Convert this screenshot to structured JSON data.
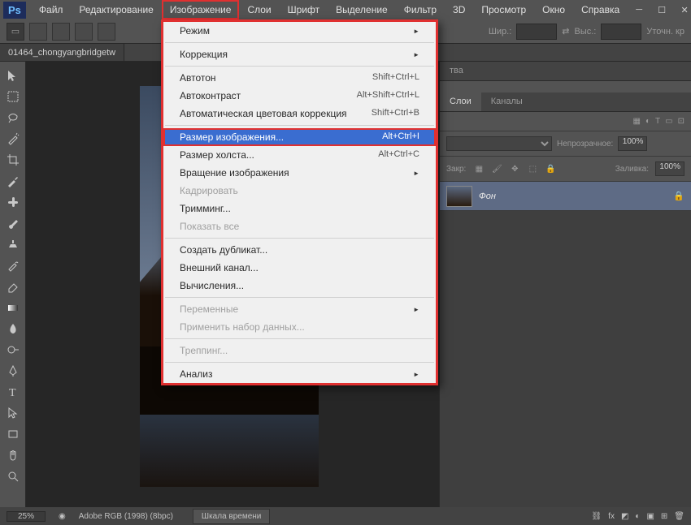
{
  "app_abbr": "Ps",
  "menubar": {
    "items": [
      "Файл",
      "Редактирование",
      "Изображение",
      "Слои",
      "Шрифт",
      "Выделение",
      "Фильтр",
      "3D",
      "Просмотр",
      "Окно",
      "Справка"
    ],
    "active_index": 2
  },
  "optionsbar": {
    "width_label": "Шир.:",
    "height_label": "Выс.:",
    "refine_label": "Уточн. кр"
  },
  "tab": {
    "title": "01464_chongyangbridgetw"
  },
  "dropdown": {
    "groups": [
      [
        {
          "label": "Режим",
          "shortcut": "",
          "arrow": true
        }
      ],
      [
        {
          "label": "Коррекция",
          "shortcut": "",
          "arrow": true
        }
      ],
      [
        {
          "label": "Автотон",
          "shortcut": "Shift+Ctrl+L"
        },
        {
          "label": "Автоконтраст",
          "shortcut": "Alt+Shift+Ctrl+L"
        },
        {
          "label": "Автоматическая цветовая коррекция",
          "shortcut": "Shift+Ctrl+B"
        }
      ],
      [
        {
          "label": "Размер изображения...",
          "shortcut": "Alt+Ctrl+I",
          "highlight": true
        },
        {
          "label": "Размер холста...",
          "shortcut": "Alt+Ctrl+C"
        },
        {
          "label": "Вращение изображения",
          "shortcut": "",
          "arrow": true
        },
        {
          "label": "Кадрировать",
          "shortcut": "",
          "disabled": true
        },
        {
          "label": "Тримминг...",
          "shortcut": ""
        },
        {
          "label": "Показать все",
          "shortcut": "",
          "disabled": true
        }
      ],
      [
        {
          "label": "Создать дубликат...",
          "shortcut": ""
        },
        {
          "label": "Внешний канал...",
          "shortcut": ""
        },
        {
          "label": "Вычисления...",
          "shortcut": ""
        }
      ],
      [
        {
          "label": "Переменные",
          "shortcut": "",
          "arrow": true,
          "disabled": true
        },
        {
          "label": "Применить набор данных...",
          "shortcut": "",
          "disabled": true
        }
      ],
      [
        {
          "label": "Треппинг...",
          "shortcut": "",
          "disabled": true
        }
      ],
      [
        {
          "label": "Анализ",
          "shortcut": "",
          "arrow": true
        }
      ]
    ]
  },
  "rightpanel": {
    "upper_tab": "тва",
    "tabs": [
      "Слои",
      "Каналы"
    ],
    "opacity_label": "Непрозрачное:",
    "opacity_value": "100%",
    "lock_label": "Закр:",
    "fill_label": "Заливка:",
    "fill_value": "100%",
    "layer": {
      "name": "Фон"
    }
  },
  "statusbar": {
    "zoom": "25%",
    "colorspace": "Adobe RGB (1998) (8bpc)",
    "timeline": "Шкала времени"
  }
}
